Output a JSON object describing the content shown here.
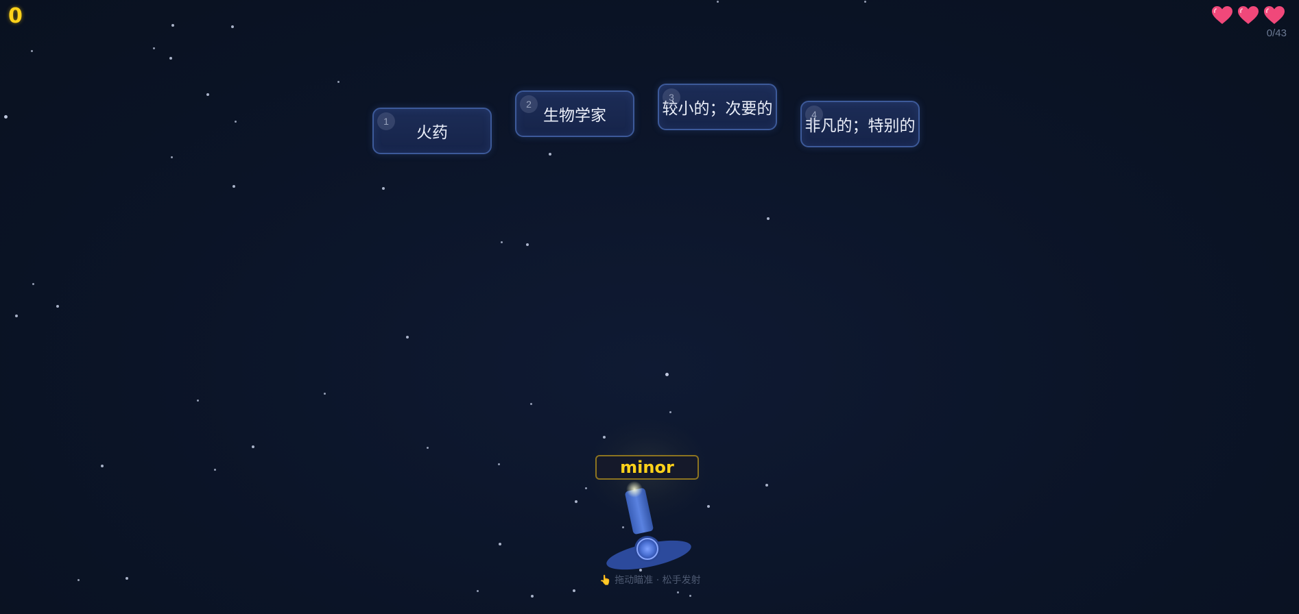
{
  "hud": {
    "score": "0",
    "lives": 3,
    "progress": "0/43"
  },
  "answers": [
    {
      "number": "1",
      "text": "火药"
    },
    {
      "number": "2",
      "text": "生物学家"
    },
    {
      "number": "3",
      "text": "较小的；次要的"
    },
    {
      "number": "4",
      "text": "非凡的；特别的"
    }
  ],
  "cannon": {
    "word": "minor",
    "hint": "👆 拖动瞄准 · 松手发射"
  },
  "colors": {
    "background": "#0b1325",
    "score": "#ffd21a",
    "heart": "#f0487a",
    "bubble_border": "#3d5a9a",
    "word_border": "#8d7420"
  },
  "icons": {
    "life": "heart-icon",
    "cannon": "cannon-icon"
  }
}
